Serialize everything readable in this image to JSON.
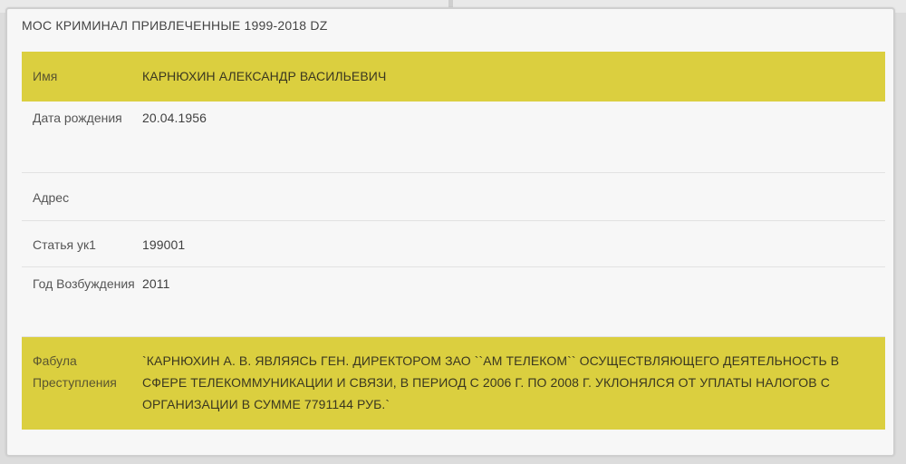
{
  "record": {
    "title": "МОС КРИМИНАЛ ПРИВЛЕЧЕННЫЕ 1999-2018 DZ",
    "rows": [
      {
        "label": "Имя",
        "value": "КАРНЮХИН АЛЕКСАНДР ВАСИЛЬЕВИЧ"
      },
      {
        "label": "Дата рождения",
        "value": "20.04.1956"
      },
      {
        "label": "Адрес",
        "value": ""
      },
      {
        "label": "Статья ук1",
        "value": "199001"
      },
      {
        "label": "Год Возбуждения",
        "value": "2011"
      },
      {
        "label": "Фабула Преступления",
        "value": "`КАРНЮХИН А. В. ЯВЛЯЯСЬ ГЕН. ДИРЕКТОРОМ ЗАО ``АМ ТЕЛЕКОМ`` ОСУЩЕСТВЛЯЮЩЕГО ДЕЯТЕЛЬНОСТЬ В СФЕРЕ ТЕЛЕКОММУНИКАЦИИ И СВЯЗИ, В ПЕРИОД С 2006 Г. ПО 2008 Г. УКЛОНЯЛСЯ ОТ УПЛАТЫ НАЛОГОВ С ОРГАНИЗАЦИИ В СУММЕ 7791144 РУБ.`"
      }
    ]
  },
  "colors": {
    "highlight": "#dbcf3f",
    "card_background": "#f7f7f7",
    "page_background": "#dcdcdc"
  }
}
